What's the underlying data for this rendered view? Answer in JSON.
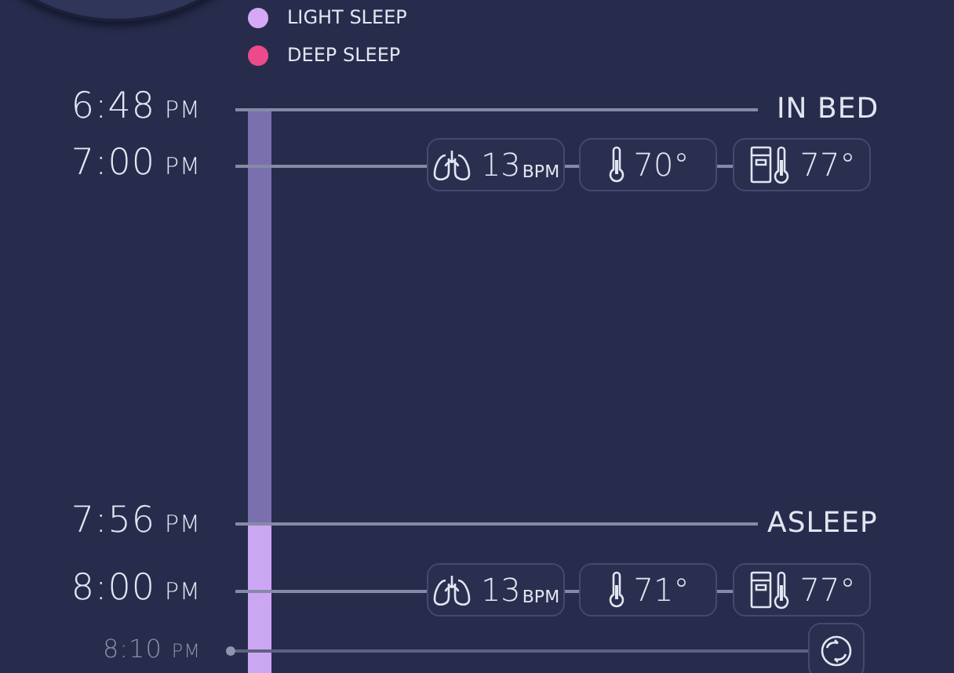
{
  "legend": [
    {
      "label": "LIGHT SLEEP",
      "color": "#d7a8f5"
    },
    {
      "label": "DEEP SLEEP",
      "color": "#ec4b8b"
    }
  ],
  "bar_segments": [
    {
      "color": "#7b70ae"
    },
    {
      "color": "#cba6f2"
    }
  ],
  "events": [
    {
      "kind": "marker",
      "time": "6:48",
      "period": "PM",
      "label": "IN BED"
    },
    {
      "kind": "readings",
      "time": "7:00",
      "period": "PM",
      "readings": [
        {
          "kind": "breath",
          "value": "13",
          "unit": "BPM"
        },
        {
          "kind": "room-temp",
          "value": "70°"
        },
        {
          "kind": "bed-temp",
          "value": "77°"
        }
      ]
    },
    {
      "kind": "marker",
      "time": "7:56",
      "period": "PM",
      "label": "ASLEEP"
    },
    {
      "kind": "readings",
      "time": "8:00",
      "period": "PM",
      "readings": [
        {
          "kind": "breath",
          "value": "13",
          "unit": "BPM"
        },
        {
          "kind": "room-temp",
          "value": "71°"
        },
        {
          "kind": "bed-temp",
          "value": "77°"
        }
      ]
    },
    {
      "kind": "action",
      "time": "8:10",
      "period": "PM"
    }
  ]
}
